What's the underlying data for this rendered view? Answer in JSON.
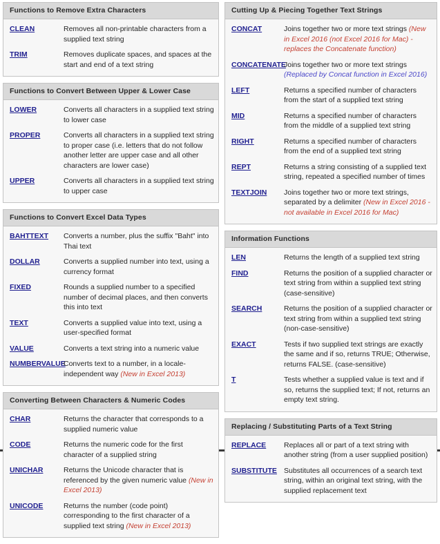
{
  "colors": {
    "link": "#1f1f8f",
    "header_bg": "#d9d9d9",
    "body_bg": "#f7f7f7",
    "note_new": "#c43f31",
    "note_replaced": "#4a47c9",
    "border": "#c3c3c3"
  },
  "left_column": [
    {
      "title": "Functions to Remove Extra Characters",
      "rows": [
        {
          "name": "CLEAN",
          "desc": "Removes all non-printable characters from a supplied text string"
        },
        {
          "name": "TRIM",
          "desc": "Removes duplicate spaces, and spaces at the start and end of a text string"
        }
      ]
    },
    {
      "title": "Functions to Convert Between Upper & Lower Case",
      "rows": [
        {
          "name": "LOWER",
          "desc": "Converts all characters in a supplied text string to lower case"
        },
        {
          "name": "PROPER",
          "desc": "Converts all characters in a supplied text string to proper case (i.e. letters that do not follow another letter are upper case and all other characters are lower case)"
        },
        {
          "name": "UPPER",
          "desc": "Converts all characters in a supplied text string to upper case"
        }
      ]
    },
    {
      "title": "Functions to Convert Excel Data Types",
      "rows": [
        {
          "name": "BAHTTEXT",
          "desc": "Converts a number, plus the suffix \"Baht\" into Thai text"
        },
        {
          "name": "DOLLAR",
          "desc": "Converts a supplied number into text, using a currency format"
        },
        {
          "name": "FIXED",
          "desc": "Rounds a supplied number to a specified number of decimal places, and then converts this into text"
        },
        {
          "name": "TEXT",
          "desc": "Converts a supplied value into text, using a user-specified format"
        },
        {
          "name": "VALUE",
          "desc": "Converts a text string into a numeric value"
        },
        {
          "name": "NUMBERVALUE",
          "desc": "Converts text to a number, in a locale-independent way ",
          "note": "(New in Excel 2013)",
          "note_type": "new"
        }
      ]
    },
    {
      "title": "Converting Between Characters & Numeric Codes",
      "rows": [
        {
          "name": "CHAR",
          "desc": "Returns the character that corresponds to a supplied numeric value"
        },
        {
          "name": "CODE",
          "desc": "Returns the numeric code for the first character of a supplied string"
        },
        {
          "name": "UNICHAR",
          "desc": "Returns the Unicode character that is referenced by the given numeric value ",
          "note": "(New in Excel 2013)",
          "note_type": "new"
        },
        {
          "name": "UNICODE",
          "desc": "Returns the number (code point) corresponding to the first character of a supplied text string ",
          "note": "(New in Excel 2013)",
          "note_type": "new"
        }
      ]
    }
  ],
  "right_column": [
    {
      "title": "Cutting Up & Piecing Together Text Strings",
      "rows": [
        {
          "name": "CONCAT",
          "desc": "Joins together two or more text strings ",
          "note": "(New in Excel 2016 (not Excel 2016 for Mac) - replaces the Concatenate function)",
          "note_type": "new"
        },
        {
          "name": "CONCATENATE",
          "desc": "Joins together two or more text strings ",
          "note": "(Replaced by Concat function in Excel 2016)",
          "note_type": "replaced"
        },
        {
          "name": "LEFT",
          "desc": "Returns a specified number of characters from the start of a supplied text string"
        },
        {
          "name": "MID",
          "desc": "Returns a specified number of characters from the middle of a supplied text string"
        },
        {
          "name": "RIGHT",
          "desc": "Returns a specified number of characters from the end of a supplied text string"
        },
        {
          "name": "REPT",
          "desc": "Returns a string consisting of a supplied text string, repeated a specified number of times"
        },
        {
          "name": "TEXTJOIN",
          "desc": "Joins together two or more text strings, separated by a delimiter ",
          "note": "(New in Excel 2016 - not available in Excel 2016 for Mac)",
          "note_type": "new"
        }
      ]
    },
    {
      "title": "Information Functions",
      "rows": [
        {
          "name": "LEN",
          "desc": "Returns the length of a supplied text string"
        },
        {
          "name": "FIND",
          "desc": "Returns the position of a supplied character or text string from within a supplied text string (case-sensitive)"
        },
        {
          "name": "SEARCH",
          "desc": "Returns the position of a supplied character or text string from within a supplied text string (non-case-sensitive)"
        },
        {
          "name": "EXACT",
          "desc": "Tests if two supplied text strings are exactly the same and if so, returns TRUE; Otherwise, returns FALSE. (case-sensitive)"
        },
        {
          "name": "T",
          "desc": "Tests whether a supplied value is text and if so, returns the supplied text; If not, returns an empty text string."
        }
      ]
    },
    {
      "title": "Replacing / Substituting Parts of a Text String",
      "rows": [
        {
          "name": "REPLACE",
          "desc": "Replaces all or part of a text string with another string (from a user supplied position)"
        },
        {
          "name": "SUBSTITUTE",
          "desc": "Substitutes all occurrences of a search text string, within an original text string, with the supplied replacement text"
        }
      ]
    }
  ]
}
